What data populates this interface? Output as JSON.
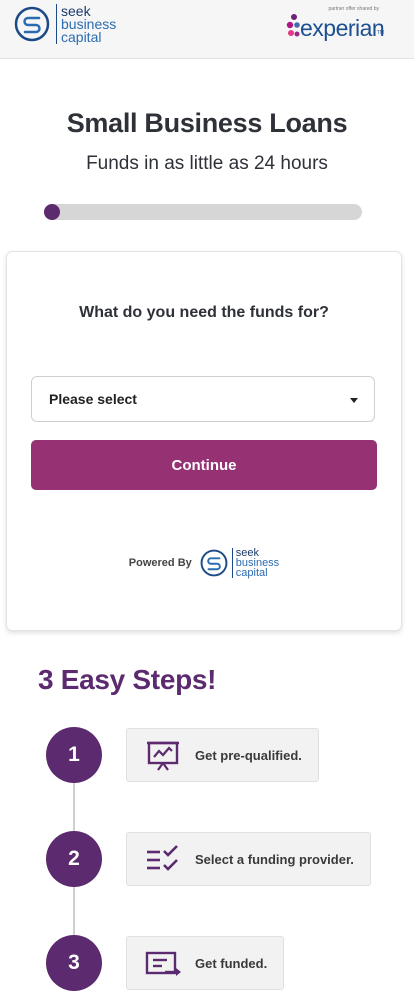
{
  "header": {
    "brand": {
      "line1": "seek",
      "line2": "business",
      "line3": "capital"
    },
    "partner": {
      "tagline": "partner offer shared by",
      "name": "experian",
      "tm": "TM"
    }
  },
  "hero": {
    "title": "Small Business Loans",
    "subtitle": "Funds in as little as 24 hours",
    "progress": 0.05
  },
  "form": {
    "question": "What do you need the funds for?",
    "select_value": "Please select",
    "continue_label": "Continue",
    "powered_label": "Powered By",
    "powered_brand": {
      "line1": "seek",
      "line2": "business",
      "line3": "capital"
    }
  },
  "steps": {
    "title": "3 Easy Steps!",
    "items": [
      {
        "number": "1",
        "label": "Get pre-qualified.",
        "icon": "presentation-chart-icon"
      },
      {
        "number": "2",
        "label": "Select a funding provider.",
        "icon": "checklist-icon"
      },
      {
        "number": "3",
        "label": "Get funded.",
        "icon": "transfer-icon"
      }
    ]
  },
  "colors": {
    "brand_purple": "#5c2a6e",
    "button": "#963174",
    "seek_blue": "#1c4a86"
  }
}
